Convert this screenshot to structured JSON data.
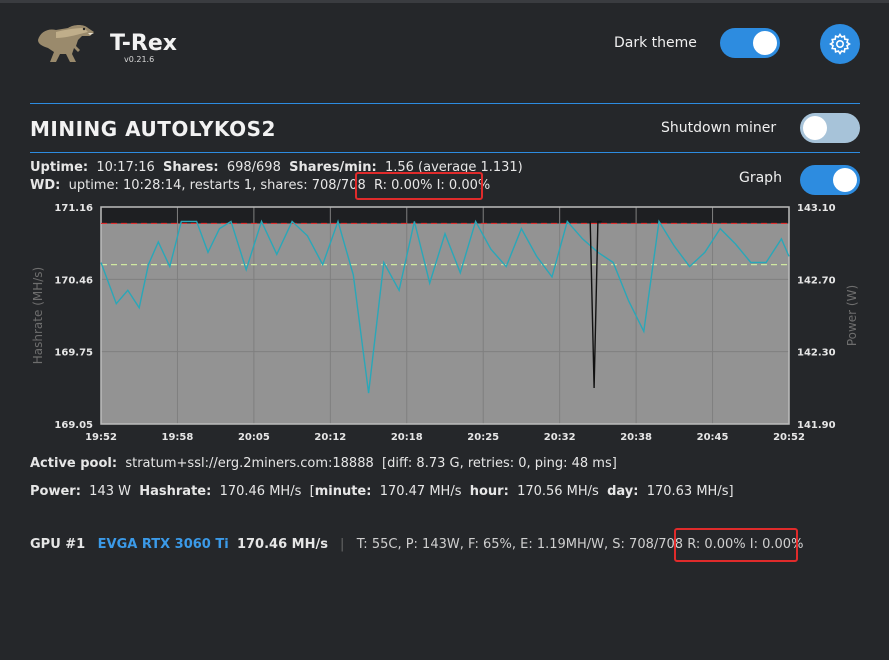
{
  "header": {
    "app_name": "T-Rex",
    "version": "v0.21.6",
    "dark_theme_label": "Dark theme",
    "dark_theme_on": true,
    "settings_icon": "gear-icon"
  },
  "mining": {
    "title": "MINING AUTOLYKOS2",
    "shutdown_label": "Shutdown miner",
    "shutdown_on": false,
    "graph_label": "Graph",
    "graph_on": true
  },
  "stats": {
    "uptime_label": "Uptime:",
    "uptime_value": "10:17:16",
    "shares_label": "Shares:",
    "shares_value": "698/698",
    "shares_min_label": "Shares/min:",
    "shares_min_value": "1.56 (average 1.131)",
    "wd_label": "WD:",
    "wd_value": "uptime: 10:28:14, restarts 1, shares: 708/708",
    "wd_ri": "R: 0.00% I: 0.00%"
  },
  "chart_data": {
    "type": "line",
    "ylabel": "Hashrate (MH/s)",
    "y2label": "Power (W)",
    "ylim": [
      169.05,
      171.16
    ],
    "y2lim": [
      141.9,
      143.1
    ],
    "yticks": [
      "171.16",
      "170.46",
      "169.75",
      "169.05"
    ],
    "y2ticks": [
      "143.10",
      "142.70",
      "142.30",
      "141.90"
    ],
    "xticks": [
      "19:52",
      "19:58",
      "20:05",
      "20:12",
      "20:18",
      "20:25",
      "20:32",
      "20:38",
      "20:45",
      "20:52"
    ],
    "reference_lines": [
      {
        "kind": "red-dashed",
        "value": 171.0
      },
      {
        "kind": "green-dashed",
        "value": 170.6
      }
    ],
    "series": [
      {
        "name": "Hashrate",
        "color": "#2aa7b8",
        "x": [
          0,
          0.2,
          0.35,
          0.5,
          0.62,
          0.75,
          0.9,
          1.05,
          1.25,
          1.4,
          1.55,
          1.7,
          1.9,
          2.1,
          2.3,
          2.5,
          2.7,
          2.9,
          3.1,
          3.3,
          3.5,
          3.7,
          3.9,
          4.1,
          4.3,
          4.5,
          4.7,
          4.9,
          5.1,
          5.3,
          5.5,
          5.7,
          5.9,
          6.1,
          6.3,
          6.5,
          6.7,
          6.9,
          7.1,
          7.3,
          7.5,
          7.7,
          7.9,
          8.1,
          8.3,
          8.5,
          8.7,
          8.9,
          9.0
        ],
        "values": [
          170.62,
          170.22,
          170.35,
          170.18,
          170.6,
          170.82,
          170.58,
          171.02,
          171.02,
          170.72,
          170.95,
          171.02,
          170.55,
          171.02,
          170.7,
          171.02,
          170.88,
          170.6,
          171.02,
          170.5,
          169.35,
          170.62,
          170.35,
          171.02,
          170.42,
          170.9,
          170.52,
          171.02,
          170.75,
          170.58,
          170.95,
          170.68,
          170.48,
          171.02,
          170.85,
          170.72,
          170.62,
          170.25,
          169.95,
          171.02,
          170.78,
          170.58,
          170.72,
          170.95,
          170.8,
          170.62,
          170.62,
          170.85,
          170.68
        ]
      },
      {
        "name": "Power",
        "color": "#111111",
        "x": [
          6.4,
          6.45,
          6.5,
          6.55
        ],
        "values": [
          171.02,
          169.4,
          171.02,
          171.02
        ]
      }
    ]
  },
  "pool": {
    "label": "Active pool:",
    "value": "stratum+ssl://erg.2miners.com:18888",
    "extra": "[diff: 8.73 G, retries: 0, ping: 48 ms]"
  },
  "power": {
    "power_label": "Power:",
    "power_value": "143 W",
    "hashrate_label": "Hashrate:",
    "hashrate_value": "170.46 MH/s",
    "minute_label": "minute:",
    "minute_value": "170.47 MH/s",
    "hour_label": "hour:",
    "hour_value": "170.56 MH/s",
    "day_label": "day:",
    "day_value": "170.63 MH/s"
  },
  "gpu": {
    "id": "GPU #1",
    "name": "EVGA RTX 3060 Ti",
    "hashrate": "170.46 MH/s",
    "details": "T: 55C, P: 143W, F: 65%, E: 1.19MH/W, S: 708/708",
    "ri": "R: 0.00% I: 0.00%"
  },
  "colors": {
    "accent": "#2d8ce0",
    "highlight_box": "#e02b2b",
    "gpu_name": "#3b9ae8"
  }
}
